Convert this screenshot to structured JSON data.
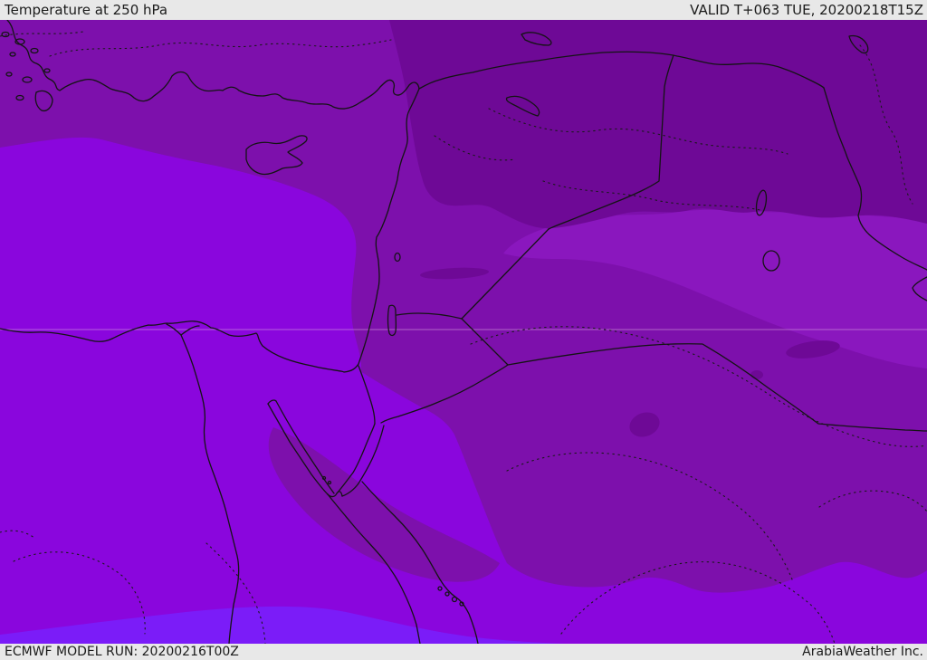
{
  "header": {
    "title": "Temperature at 250 hPa",
    "valid_label": "VALID T+063 TUE, 20200218T15Z"
  },
  "footer": {
    "model_run": "ECMWF MODEL RUN: 20200216T00Z",
    "provider": "ArabiaWeather Inc."
  },
  "map": {
    "parameter": "Temperature",
    "level": "250 hPa",
    "model": "ECMWF",
    "run_datetime": "20200216T00Z",
    "valid_datetime": "20200218T15Z",
    "forecast_step": "T+063",
    "valid_day": "TUE",
    "bar_bg": "#E8E8E8",
    "bar_text_color": "#1B1B1B",
    "outline_color": "#141414",
    "dotted_color": "#1A1A1A",
    "latitude_line_color": "#DCA8E2",
    "bands": [
      {
        "name": "dark-purple-coldest",
        "color": "#6E0996"
      },
      {
        "name": "medium-purple",
        "color": "#7D10AC"
      },
      {
        "name": "light-purple",
        "color": "#8A17BE"
      },
      {
        "name": "bright-violet",
        "color": "#8A06DD"
      },
      {
        "name": "blue-violet",
        "color": "#7B1CF8"
      }
    ],
    "regions": [
      {
        "area": "northeast (Syria / northern Iraq / SE Turkey)",
        "band": "dark-purple-coldest"
      },
      {
        "area": "Turkey and central belt (Jordan, central Saudi Arabia)",
        "band": "medium-purple"
      },
      {
        "area": "band along Persian Gulf / southern Iraq",
        "band": "light-purple"
      },
      {
        "area": "eastern Mediterranean, Egypt, Sinai and southern strip",
        "band": "bright-violet"
      },
      {
        "area": "bottom-left corner (southern Egypt)",
        "band": "blue-violet"
      }
    ]
  }
}
